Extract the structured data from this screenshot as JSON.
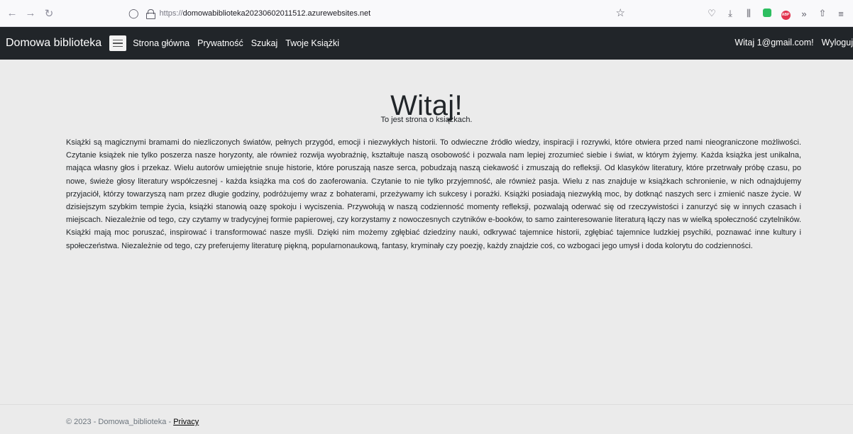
{
  "browser": {
    "url_protocol": "https://",
    "url_host": "domowabiblioteka20230602011512.azurewebsites.net"
  },
  "navbar": {
    "brand": "Domowa biblioteka",
    "links": [
      "Strona główna",
      "Prywatność",
      "Szukaj",
      "Twoje Książki"
    ],
    "greeting": "Witaj 1@gmail.com!",
    "logout": "Wyloguj"
  },
  "main": {
    "title": "Witaj!",
    "subtitle": "To jest strona o książkach.",
    "paragraph": "Książki są magicznymi bramami do niezliczonych światów, pełnych przygód, emocji i niezwykłych historii. To odwieczne źródło wiedzy, inspiracji i rozrywki, które otwiera przed nami nieograniczone możliwości. Czytanie książek nie tylko poszerza nasze horyzonty, ale również rozwija wyobraźnię, kształtuje naszą osobowość i pozwala nam lepiej zrozumieć siebie i świat, w którym żyjemy. Każda książka jest unikalna, mająca własny głos i przekaz. Wielu autorów umiejętnie snuje historie, które poruszają nasze serca, pobudzają naszą ciekawość i zmuszają do refleksji. Od klasyków literatury, które przetrwały próbę czasu, po nowe, świeże głosy literatury współczesnej - każda książka ma coś do zaoferowania. Czytanie to nie tylko przyjemność, ale również pasja. Wielu z nas znajduje w książkach schronienie, w nich odnajdujemy przyjaciół, którzy towarzyszą nam przez długie godziny, podróżujemy wraz z bohaterami, przeżywamy ich sukcesy i porażki. Książki posiadają niezwykłą moc, by dotknąć naszych serc i zmienić nasze życie. W dzisiejszym szybkim tempie życia, książki stanowią oazę spokoju i wyciszenia. Przywołują w naszą codzienność momenty refleksji, pozwalają oderwać się od rzeczywistości i zanurzyć się w innych czasach i miejscach. Niezależnie od tego, czy czytamy w tradycyjnej formie papierowej, czy korzystamy z nowoczesnych czytników e-booków, to samo zainteresowanie literaturą łączy nas w wielką społeczność czytelników. Książki mają moc poruszać, inspirować i transformować nasze myśli. Dzięki nim możemy zgłębiać dziedziny nauki, odkrywać tajemnice historii, zgłębiać tajemnice ludzkiej psychiki, poznawać inne kultury i społeczeństwa. Niezależnie od tego, czy preferujemy literaturę piękną, popularnonaukową, fantasy, kryminały czy poezję, każdy znajdzie coś, co wzbogaci jego umysł i doda kolorytu do codzienności."
  },
  "footer": {
    "text": "© 2023 - Domowa_biblioteka - ",
    "link": "Privacy"
  },
  "colors": {
    "navbar_bg": "#212529",
    "page_bg": "#ebebeb",
    "text": "#212529",
    "footer_text": "#6c757d"
  },
  "icons": [
    "back-arrow-icon",
    "forward-arrow-icon",
    "reload-icon",
    "shield-icon",
    "lock-icon",
    "bookmark-star-icon",
    "pocket-icon",
    "download-icon",
    "library-icon",
    "evernote-icon",
    "adblock-plus-icon",
    "extensions-overflow-icon",
    "share-icon",
    "menu-icon",
    "hamburger-icon"
  ]
}
